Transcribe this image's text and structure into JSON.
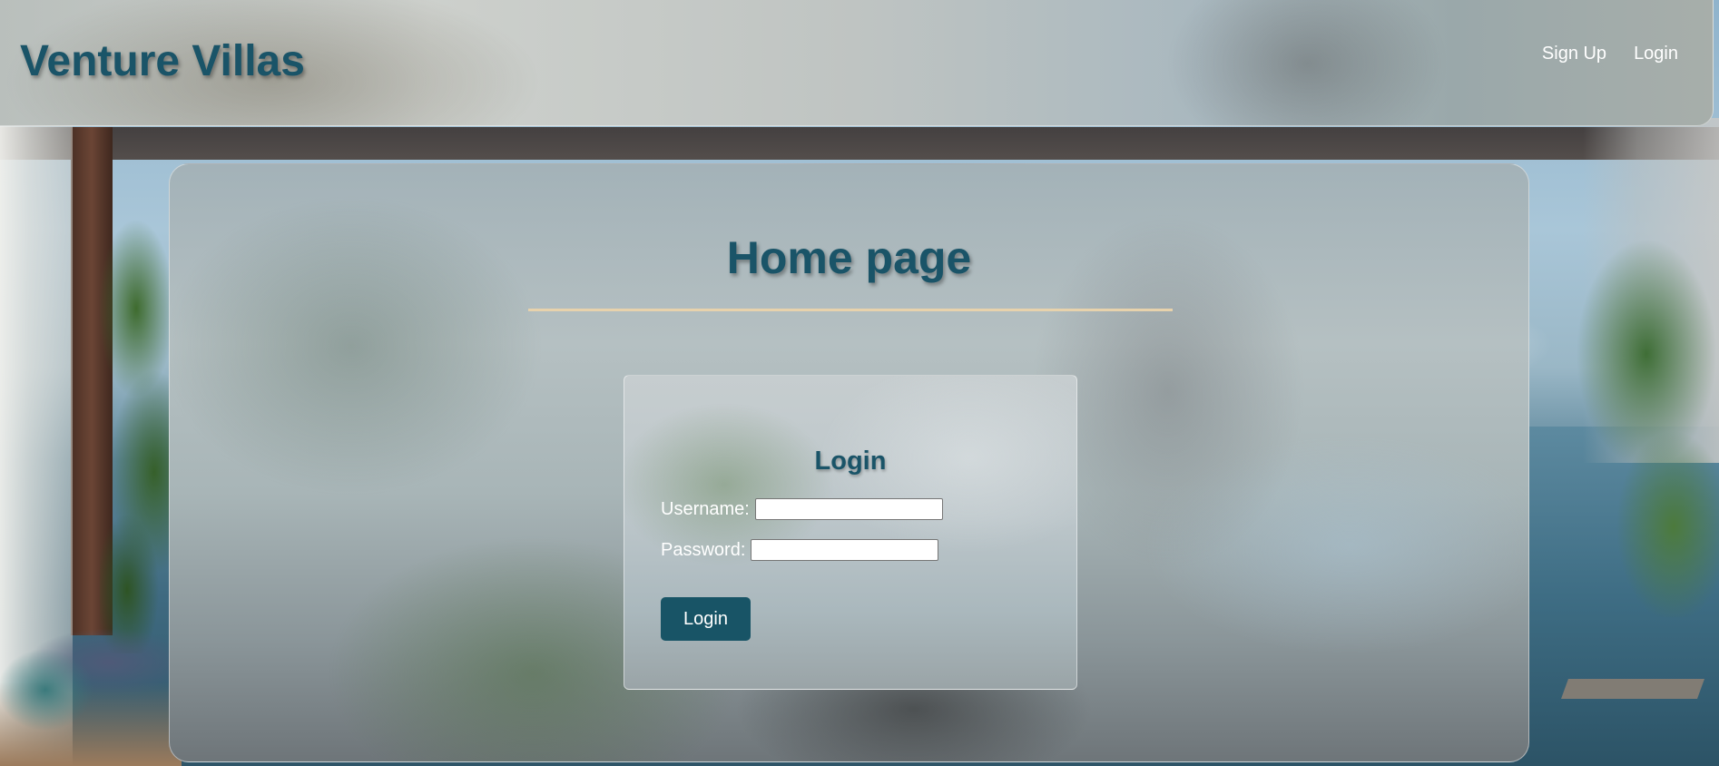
{
  "header": {
    "brand": "Venture Villas",
    "nav": [
      {
        "label": "Sign Up"
      },
      {
        "label": "Login"
      }
    ]
  },
  "main": {
    "title": "Home page"
  },
  "login_form": {
    "title": "Login",
    "username_label": "Username:",
    "username_value": "",
    "password_label": "Password:",
    "password_value": "",
    "submit_label": "Login"
  },
  "colors": {
    "brand_text": "#1a5468",
    "button_bg": "#185466",
    "divider": "#e7d2ac",
    "nav_text": "#ffffff"
  }
}
